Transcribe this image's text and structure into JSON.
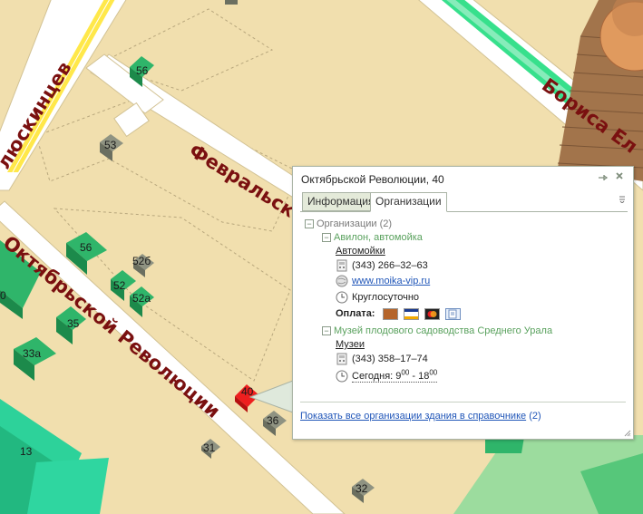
{
  "map": {
    "streets": [
      {
        "name": "Челюскинцев",
        "shown": "люскинцев"
      },
      {
        "name": "Февральской",
        "shown": "Февральск"
      },
      {
        "name": "Октябрьской Революции",
        "shown": "Октябрьской Революции"
      },
      {
        "name": "Бориса Ельцина",
        "shown": "Бориса Ел"
      }
    ],
    "buildings": [
      "56",
      "53",
      "56",
      "52б",
      "52",
      "52а",
      "35",
      "33а",
      "40",
      "36",
      "31",
      "13",
      "32",
      "21",
      "0"
    ],
    "colors": {
      "ground": "#f1dfae",
      "building_green": "#2fb56a",
      "building_gray": "#8f9382",
      "selected": "#ee1f1f",
      "rail": "#ffe84a",
      "tram": "#37e08c",
      "park": "#56c77a"
    }
  },
  "popup": {
    "title": "Октябрьской Революции, 40",
    "pin_icon": "pin-icon",
    "close_icon": "close-icon",
    "tabs": [
      {
        "label": "Информация",
        "active": false
      },
      {
        "label": "Организации",
        "active": true
      }
    ],
    "tree": {
      "root_label": "Организации (2)",
      "orgs": [
        {
          "name": "Авилон, автомойка",
          "category": "Автомойки",
          "phone": "(343) 266–32–63",
          "website": "www.moika-vip.ru",
          "hours": "Круглосуточно",
          "payment_label": "Оплата:",
          "payment_methods": [
            "wallet-icon",
            "visa-icon",
            "mastercard-icon",
            "check-icon"
          ]
        },
        {
          "name": "Музей плодового садоводства Среднего Урала",
          "category": "Музеи",
          "phone": "(343) 358–17–74",
          "hours_prefix": "Сегодня: 9",
          "hours_sup1": "00",
          "hours_mid": " - 18",
          "hours_sup2": "00"
        }
      ]
    },
    "footer_link": "Показать все организации здания в справочнике",
    "footer_count": "(2)"
  }
}
